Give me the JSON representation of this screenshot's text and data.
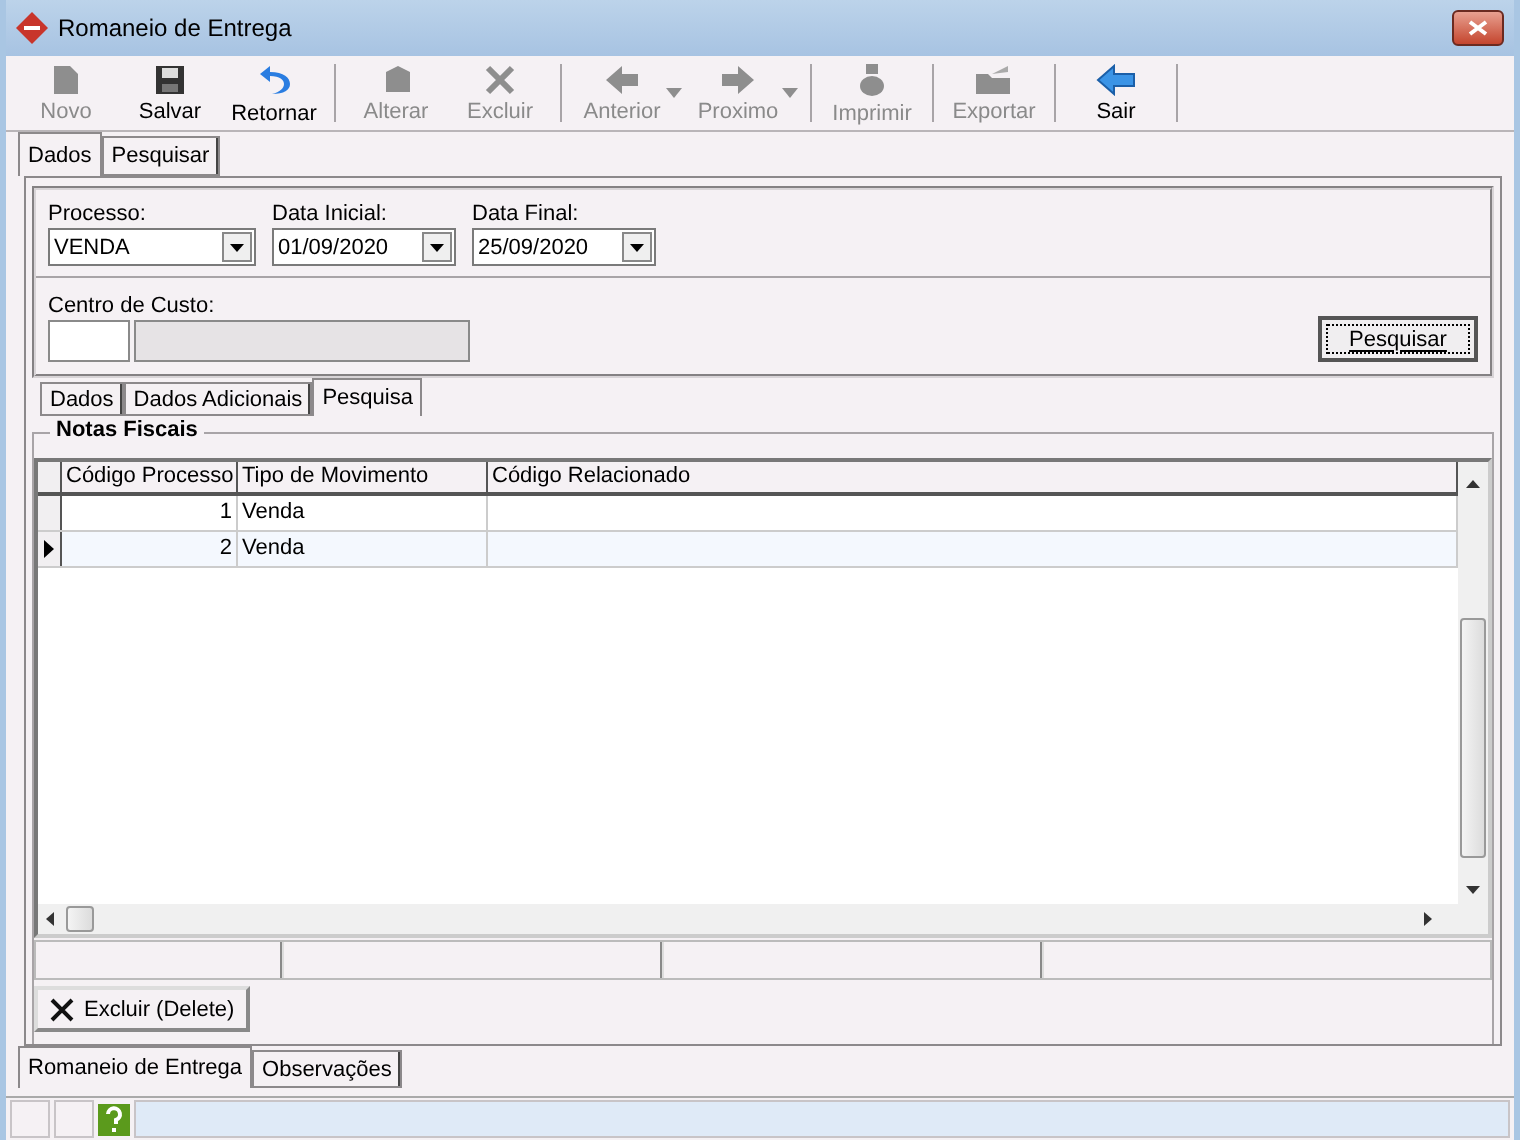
{
  "window": {
    "title": "Romaneio de Entrega"
  },
  "toolbar": {
    "groups": [
      [
        {
          "label": "Novo",
          "kind": "new",
          "disabled": true,
          "dropdown": false
        },
        {
          "label": "Salvar",
          "kind": "save",
          "disabled": false,
          "dropdown": false
        },
        {
          "label": "Retornar",
          "kind": "undo",
          "disabled": false,
          "dropdown": false
        }
      ],
      [
        {
          "label": "Alterar",
          "kind": "edit",
          "disabled": true,
          "dropdown": false
        },
        {
          "label": "Excluir",
          "kind": "delete",
          "disabled": true,
          "dropdown": false
        }
      ],
      [
        {
          "label": "Anterior",
          "kind": "prev",
          "disabled": true,
          "dropdown": true
        },
        {
          "label": "Proximo",
          "kind": "next",
          "disabled": true,
          "dropdown": true
        }
      ],
      [
        {
          "label": "Imprimir",
          "kind": "print",
          "disabled": true,
          "dropdown": false
        }
      ],
      [
        {
          "label": "Exportar",
          "kind": "export",
          "disabled": true,
          "dropdown": false
        }
      ],
      [
        {
          "label": "Sair",
          "kind": "exit",
          "disabled": false,
          "dropdown": false
        }
      ]
    ]
  },
  "top_tabs": [
    {
      "label": "Dados",
      "selected": true
    },
    {
      "label": "Pesquisar",
      "selected": false
    }
  ],
  "filters": {
    "processo": {
      "label": "Processo:",
      "value": "VENDA"
    },
    "data_inicial": {
      "label": "Data Inicial:",
      "value": "01/09/2020"
    },
    "data_final": {
      "label": "Data Final:",
      "value": "25/09/2020"
    },
    "centro_custo": {
      "label": "Centro de Custo:"
    }
  },
  "search_button": {
    "label": "Pesquisar"
  },
  "detail_tabs": [
    {
      "label": "Dados",
      "selected": false
    },
    {
      "label": "Dados Adicionais",
      "selected": false
    },
    {
      "label": "Pesquisa",
      "selected": true
    }
  ],
  "notas_fiscais": {
    "title": "Notas Fiscais",
    "columns": [
      "Código Processo",
      "Tipo de Movimento",
      "Código Relacionado"
    ],
    "rows": [
      {
        "cells": [
          "1",
          "Venda",
          ""
        ],
        "current": false
      },
      {
        "cells": [
          "2",
          "Venda",
          ""
        ],
        "current": true
      }
    ]
  },
  "delete_button": {
    "label": "Excluir (Delete)"
  },
  "bottom_tabs": [
    {
      "label": "Romaneio de Entrega",
      "selected": true
    },
    {
      "label": "Observações",
      "selected": false
    }
  ]
}
